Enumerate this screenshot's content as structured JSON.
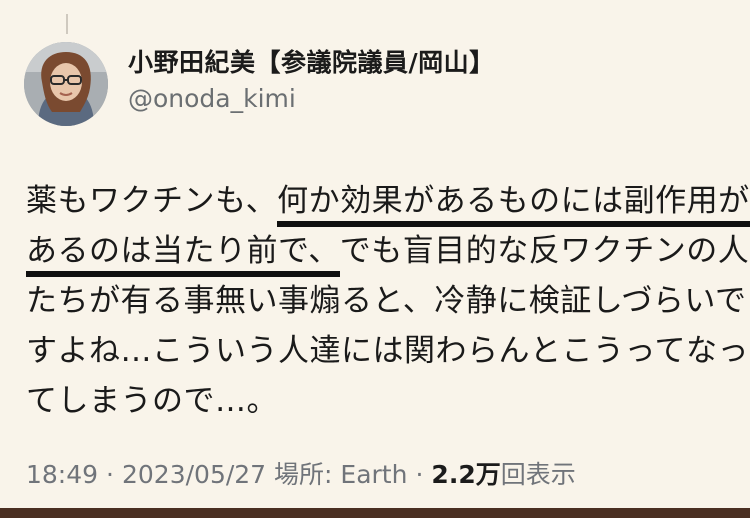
{
  "tweet": {
    "author": {
      "display_name": "小野田紀美【参議院議員/岡山】",
      "handle": "@onoda_kimi"
    },
    "body_lines": [
      {
        "pre": "薬もワクチンも、",
        "hl": "何か効果があるものには副作用が",
        "post": ""
      },
      {
        "pre": "",
        "hl": "あるのは当たり前で、",
        "post": "でも盲目的な反ワクチンの人"
      },
      {
        "pre": "たちが有る事無い事煽ると、冷静に検証しづらいで",
        "hl": "",
        "post": ""
      },
      {
        "pre": "すよね…こういう人達には関わらんとこうってなっ",
        "hl": "",
        "post": ""
      },
      {
        "pre": "てしまうので…。",
        "hl": "",
        "post": ""
      }
    ],
    "meta": {
      "time": "18:49",
      "separator": "·",
      "date": "2023/05/27",
      "location": "場所: Earth",
      "views_count": "2.2万",
      "views_label": "回表示"
    }
  },
  "colors": {
    "background": "#f9f4ea",
    "text": "#1a1a1a",
    "muted": "#70747a",
    "underline": "#101010"
  }
}
